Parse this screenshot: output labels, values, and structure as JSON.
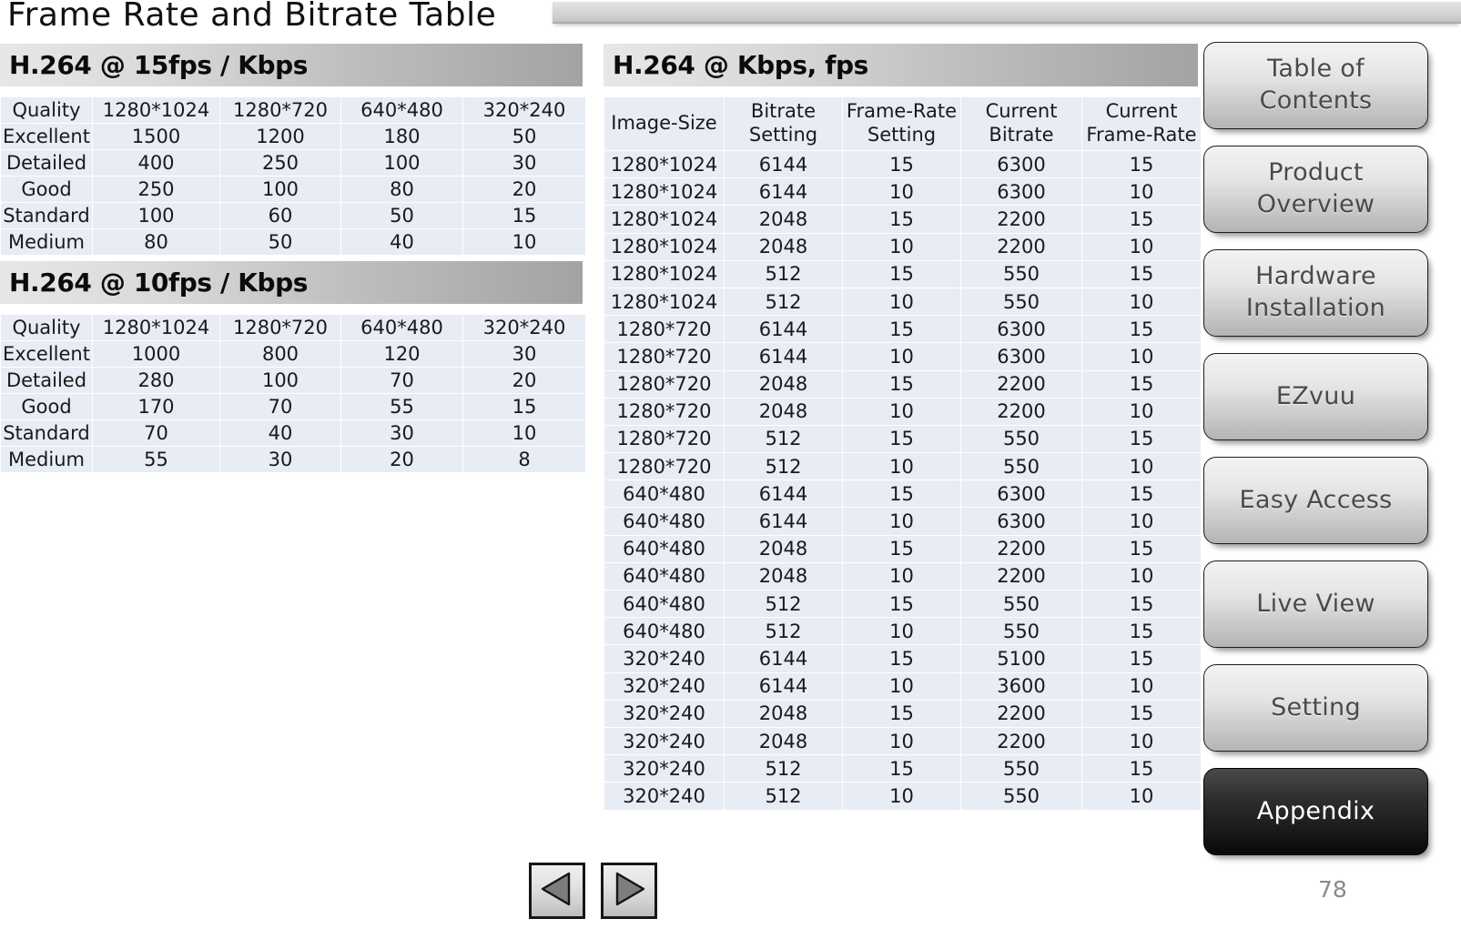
{
  "page_title": "Frame Rate and Bitrate Table",
  "page_number": "78",
  "sections": {
    "table15fps": {
      "banner": "H.264 @ 15fps / Kbps",
      "headers": [
        "Quality",
        "1280*1024",
        "1280*720",
        "640*480",
        "320*240"
      ],
      "rows": [
        [
          "Excellent",
          "1500",
          "1200",
          "180",
          "50"
        ],
        [
          "Detailed",
          "400",
          "250",
          "100",
          "30"
        ],
        [
          "Good",
          "250",
          "100",
          "80",
          "20"
        ],
        [
          "Standard",
          "100",
          "60",
          "50",
          "15"
        ],
        [
          "Medium",
          "80",
          "50",
          "40",
          "10"
        ]
      ]
    },
    "table10fps": {
      "banner": "H.264 @ 10fps / Kbps",
      "headers": [
        "Quality",
        "1280*1024",
        "1280*720",
        "640*480",
        "320*240"
      ],
      "rows": [
        [
          "Excellent",
          "1000",
          "800",
          "120",
          "30"
        ],
        [
          "Detailed",
          "280",
          "100",
          "70",
          "20"
        ],
        [
          "Good",
          "170",
          "70",
          "55",
          "15"
        ],
        [
          "Standard",
          "70",
          "40",
          "30",
          "10"
        ],
        [
          "Medium",
          "55",
          "30",
          "20",
          "8"
        ]
      ]
    },
    "tableKbpsFps": {
      "banner": "H.264 @ Kbps, fps",
      "headers": [
        "Image-Size",
        "Bitrate Setting",
        "Frame-Rate Setting",
        "Current Bitrate",
        "Current Frame-Rate"
      ],
      "rows": [
        [
          "1280*1024",
          "6144",
          "15",
          "6300",
          "15"
        ],
        [
          "1280*1024",
          "6144",
          "10",
          "6300",
          "10"
        ],
        [
          "1280*1024",
          "2048",
          "15",
          "2200",
          "15"
        ],
        [
          "1280*1024",
          "2048",
          "10",
          "2200",
          "10"
        ],
        [
          "1280*1024",
          "512",
          "15",
          "550",
          "15"
        ],
        [
          "1280*1024",
          "512",
          "10",
          "550",
          "10"
        ],
        [
          "1280*720",
          "6144",
          "15",
          "6300",
          "15"
        ],
        [
          "1280*720",
          "6144",
          "10",
          "6300",
          "10"
        ],
        [
          "1280*720",
          "2048",
          "15",
          "2200",
          "15"
        ],
        [
          "1280*720",
          "2048",
          "10",
          "2200",
          "10"
        ],
        [
          "1280*720",
          "512",
          "15",
          "550",
          "15"
        ],
        [
          "1280*720",
          "512",
          "10",
          "550",
          "10"
        ],
        [
          "640*480",
          "6144",
          "15",
          "6300",
          "15"
        ],
        [
          "640*480",
          "6144",
          "10",
          "6300",
          "10"
        ],
        [
          "640*480",
          "2048",
          "15",
          "2200",
          "15"
        ],
        [
          "640*480",
          "2048",
          "10",
          "2200",
          "10"
        ],
        [
          "640*480",
          "512",
          "15",
          "550",
          "15"
        ],
        [
          "640*480",
          "512",
          "10",
          "550",
          "15"
        ],
        [
          "320*240",
          "6144",
          "15",
          "5100",
          "15"
        ],
        [
          "320*240",
          "6144",
          "10",
          "3600",
          "10"
        ],
        [
          "320*240",
          "2048",
          "15",
          "2200",
          "15"
        ],
        [
          "320*240",
          "2048",
          "10",
          "2200",
          "10"
        ],
        [
          "320*240",
          "512",
          "15",
          "550",
          "15"
        ],
        [
          "320*240",
          "512",
          "10",
          "550",
          "10"
        ]
      ]
    }
  },
  "side_nav": {
    "items": [
      {
        "label": "Table of Contents",
        "active": false
      },
      {
        "label": "Product Overview",
        "active": false
      },
      {
        "label": "Hardware Installation",
        "active": false
      },
      {
        "label": "EZvuu",
        "active": false
      },
      {
        "label": "Easy Access",
        "active": false
      },
      {
        "label": "Live View",
        "active": false
      },
      {
        "label": "Setting",
        "active": false
      },
      {
        "label": "Appendix",
        "active": true
      }
    ]
  },
  "footer_nav": {
    "prev_icon": "triangle-left-icon",
    "next_icon": "triangle-right-icon"
  },
  "colors": {
    "cell_fill": "#e7ecf5",
    "banner_start": "#e7e7e7",
    "banner_end": "#a3a3a3",
    "active_button": "#1b1b1b",
    "page_number": "#8a8a8a"
  }
}
